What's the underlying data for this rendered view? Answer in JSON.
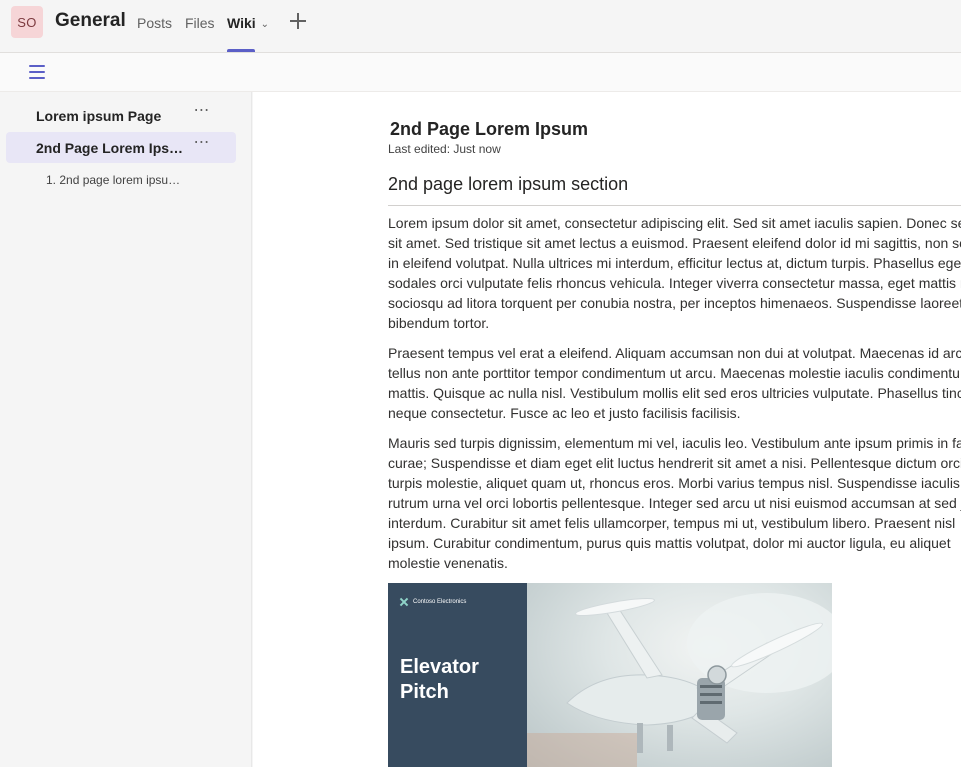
{
  "header": {
    "avatar_initials": "SO",
    "team_title": "General",
    "tabs": [
      {
        "label": "Posts"
      },
      {
        "label": "Files"
      },
      {
        "label": "Wiki"
      }
    ],
    "accent_color": "#5b5fc7"
  },
  "toolbar": {
    "menu_icon": "hamburger-menu-icon"
  },
  "sidebar": {
    "pages": [
      {
        "label": "Lorem ipsum Page",
        "more": "⋯"
      },
      {
        "label": "2nd Page Lorem Ipsum",
        "more": "⋯",
        "selected": true
      }
    ],
    "sections": [
      {
        "label": "1. 2nd page lorem ipsum section"
      }
    ]
  },
  "page": {
    "title": "2nd Page Lorem Ipsum",
    "last_edited": "Last edited: Just now",
    "section_heading": "2nd page lorem ipsum section",
    "paragraphs": [
      "Lorem ipsum dolor sit amet, consectetur adipiscing elit. Sed sit amet iaculis sapien. Donec ser\nsit amet. Sed tristique sit amet lectus a euismod. Praesent eleifend dolor id mi sagittis, non sc\nin eleifend volutpat. Nulla ultrices mi interdum, efficitur lectus at, dictum turpis. Phasellus ege\nsodales orci vulputate felis rhoncus vehicula. Integer viverra consectetur massa, eget mattis m\nsociosqu ad litora torquent per conubia nostra, per inceptos himenaeos. Suspendisse laoreet\nbibendum tortor.",
      "Praesent tempus vel erat a eleifend. Aliquam accumsan non dui at volutpat. Maecenas id arcu\ntellus non ante porttitor tempor condimentum ut arcu. Maecenas molestie iaculis condimentu\nmattis. Quisque ac nulla nisl. Vestibulum mollis elit sed eros ultricies vulputate. Phasellus tinci\nneque consectetur. Fusce ac leo et justo facilisis facilisis.",
      "Mauris sed turpis dignissim, elementum mi vel, iaculis leo. Vestibulum ante ipsum primis in fa\ncurae; Suspendisse et diam eget elit luctus hendrerit sit amet a nisi. Pellentesque dictum orci\nturpis molestie, aliquet quam ut, rhoncus eros. Morbi varius tempus nisl. Suspendisse iaculis e\nrutrum urna vel orci lobortis pellentesque. Integer sed arcu ut nisi euismod accumsan at sed j\ninterdum. Curabitur sit amet felis ullamcorper, tempus mi ut, vestibulum libero. Praesent nisl\nipsum. Curabitur condimentum, purus quis mattis volutpat, dolor mi auctor ligula, eu aliquet\nmolestie venenatis."
    ],
    "slide": {
      "brand": "Contoso Electronics",
      "title": "Elevator\nPitch"
    }
  }
}
